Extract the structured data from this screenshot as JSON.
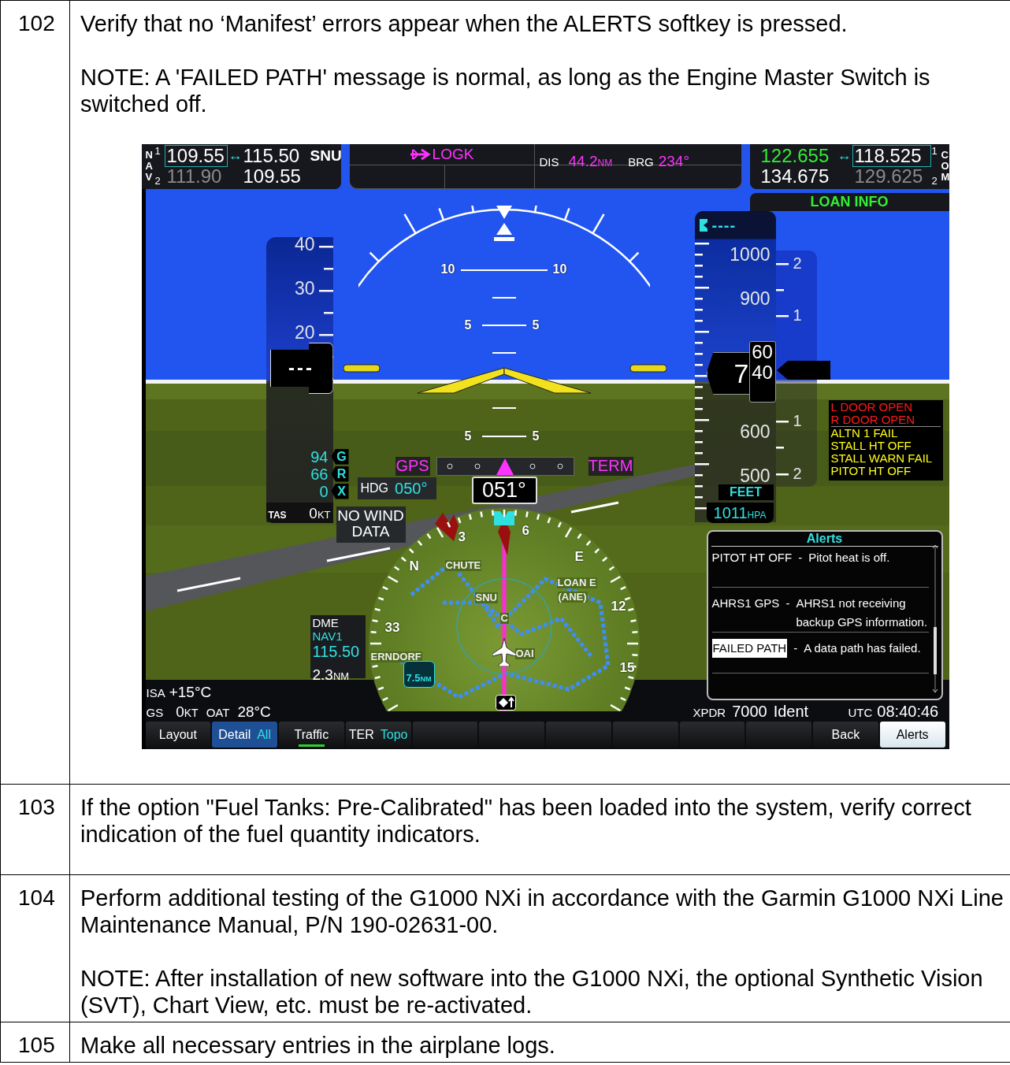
{
  "steps": [
    {
      "number": "102",
      "paragraphs": [
        "Verify that no ‘Manifest’ errors appear when the ALERTS softkey is pressed.",
        "NOTE: A 'FAILED PATH' message is normal, as long as the Engine Master Switch is switched off."
      ],
      "display": {
        "nav": {
          "label": "NAV",
          "rows": [
            {
              "index": "1",
              "standby": "109.55",
              "selected": true,
              "swap": "↔",
              "active": "115.50",
              "ident": "SNU"
            },
            {
              "index": "2",
              "standby": "111.90",
              "selected": false,
              "active": "109.55"
            }
          ]
        },
        "nav_status": {
          "waypoint": "LOGK",
          "distance_label": "DIS",
          "distance": "44.2",
          "distance_unit": "NM",
          "bearing_label": "BRG",
          "bearing": "234°"
        },
        "com": {
          "label": "COM",
          "rows": [
            {
              "index": "1",
              "active": "122.655",
              "swap": "↔",
              "standby": "118.525",
              "selected": true
            },
            {
              "index": "2",
              "active": "134.675",
              "standby": "129.625",
              "selected": false
            }
          ]
        },
        "info_bar": "LOAN INFO",
        "airspeed": {
          "tape_labels": [
            "40",
            "30",
            "20"
          ],
          "readout": "---",
          "tas_label": "TAS",
          "tas_value": "0",
          "tas_unit": "KT",
          "bugs": [
            {
              "value": "94",
              "marker": "G"
            },
            {
              "value": "66",
              "marker": "R"
            },
            {
              "value": "0",
              "marker": "X"
            }
          ]
        },
        "pitch_labels": [
          "10",
          "10",
          "5",
          "5",
          "5",
          "5"
        ],
        "heading": {
          "hdg_label": "HDG",
          "hdg_value": "050°",
          "current": "051°"
        },
        "wind": "NO WIND DATA",
        "cdi": {
          "source": "GPS",
          "phase": "TERM"
        },
        "altimeter": {
          "selected": "----",
          "tape_labels": [
            "1000",
            "900",
            "600",
            "500"
          ],
          "readout": "7",
          "roll_upper": "60",
          "roll_lower": "40",
          "unit": "FEET",
          "baro": "1011",
          "baro_unit": "HPA"
        },
        "vsi_labels": [
          "2",
          "1",
          "1",
          "2"
        ],
        "annunciations": [
          {
            "text": "L DOOR OPEN",
            "color": "#ff1a1a"
          },
          {
            "text": "R DOOR OPEN",
            "color": "#ff1a1a"
          },
          {
            "text": "ALTN 1 FAIL",
            "color": "#ffff1a"
          },
          {
            "text": "STALL HT OFF",
            "color": "#ffff1a"
          },
          {
            "text": "STALL WARN FAIL",
            "color": "#ffff1a"
          },
          {
            "text": "PITOT HT OFF",
            "color": "#ffff1a"
          }
        ],
        "inset_map": {
          "compass": [
            "N",
            "3",
            "6",
            "E",
            "12",
            "15",
            "33"
          ],
          "labels": [
            "CHUTE",
            "SNU",
            "LOAN E",
            "(ANE)",
            "C",
            "ERNDORF",
            "OAI"
          ],
          "range": "7.5",
          "range_unit": "NM"
        },
        "dme": {
          "title": "DME",
          "source": "NAV1",
          "frequency": "115.50",
          "distance": "2.3",
          "unit": "NM"
        },
        "status": {
          "isa_label": "ISA",
          "isa": "+15°C",
          "gs_label": "GS",
          "gs": "0",
          "gs_unit": "KT",
          "oat_label": "OAT",
          "oat": "28°C",
          "xpdr_label": "XPDR",
          "xpdr_code": "7000",
          "xpdr_mode": "Ident",
          "utc_label": "UTC",
          "utc": "08:40:46"
        },
        "alerts": {
          "title": "Alerts",
          "items": [
            {
              "name": "PITOT HT OFF",
              "dash": "-",
              "message": "Pitot heat is off.",
              "selected": false
            },
            {
              "name": "AHRS1 GPS",
              "dash": "-",
              "message": "AHRS1 not receiving backup GPS information.",
              "selected": false
            },
            {
              "name": "FAILED PATH",
              "dash": "-",
              "message": "A data path has failed.",
              "selected": true
            }
          ]
        },
        "softkeys": [
          {
            "kind": "key",
            "label": "Layout",
            "selected": false,
            "on": false
          },
          {
            "kind": "option",
            "label": "Detail",
            "value": "All",
            "selected": false,
            "on": false
          },
          {
            "kind": "key",
            "label": "Traffic",
            "selected": false,
            "on": true
          },
          {
            "kind": "key",
            "label": "TER",
            "value": "Topo",
            "selected": false,
            "on": false
          },
          {
            "kind": "blank"
          },
          {
            "kind": "blank"
          },
          {
            "kind": "blank"
          },
          {
            "kind": "blank"
          },
          {
            "kind": "blank"
          },
          {
            "kind": "blank"
          },
          {
            "kind": "key",
            "label": "Back",
            "selected": false,
            "on": false
          },
          {
            "kind": "key",
            "label": "Alerts",
            "selected": true,
            "on": false
          }
        ]
      }
    },
    {
      "number": "103",
      "paragraphs": [
        "If the option \"Fuel Tanks: Pre-Calibrated\" has been loaded into the system, verify correct indication of the fuel quantity indicators."
      ]
    },
    {
      "number": "104",
      "paragraphs": [
        "Perform additional testing of the G1000 NXi in accordance with the Garmin G1000 NXi Line Maintenance Manual, P/N 190-02631-00.",
        "NOTE: After installation of new software into the G1000 NXi, the optional Synthetic Vision (SVT), Chart View, etc. must be re-activated."
      ]
    },
    {
      "number": "105",
      "paragraphs": [
        "Make all necessary entries in the airplane logs."
      ]
    }
  ]
}
